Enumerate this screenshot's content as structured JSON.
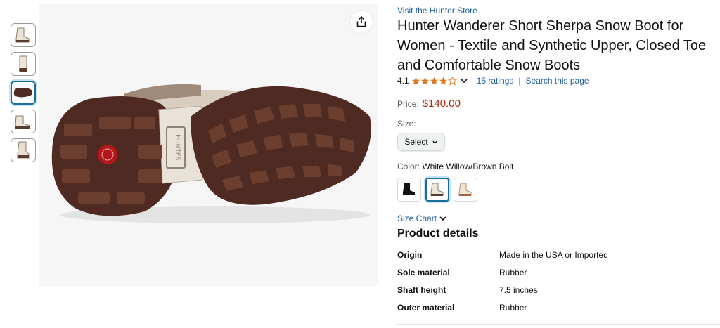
{
  "gallery": {
    "thumbnails": [
      "boot-side-view",
      "boot-front-view",
      "boot-sole-view",
      "boot-pair-view",
      "boot-model-view"
    ],
    "selected_index": 2,
    "main_image": "boot-sole-view",
    "share_icon": "share-icon"
  },
  "product": {
    "store_link": "Visit the Hunter Store",
    "title_line1": "Hunter Wanderer Short Sherpa Snow Boot for",
    "title_line2": "Women - Textile and Synthetic Upper, Closed Toe",
    "title_line3": "and Comfortable Snow Boots",
    "rating": "4.1",
    "rating_value": 4.1,
    "ratings_count": "15 ratings",
    "separator": "|",
    "search_link": "Search this page",
    "price_label": "Price:",
    "price": "$140.00",
    "size_label": "Size:",
    "size_select": "Select",
    "color_label": "Color:",
    "color_value": "White Willow/Brown Bolt",
    "color_swatches": [
      "black-boot",
      "white-willow-boot",
      "cream-boot"
    ],
    "selected_swatch": 1,
    "size_chart": "Size Chart",
    "details_heading": "Product details",
    "details": [
      {
        "key": "Origin",
        "value": "Made in the USA or Imported"
      },
      {
        "key": "Sole material",
        "value": "Rubber"
      },
      {
        "key": "Shaft height",
        "value": "7.5 inches"
      },
      {
        "key": "Outer material",
        "value": "Rubber"
      }
    ]
  },
  "colors": {
    "link": "#2162a1",
    "price": "#b12704",
    "star": "#de7921",
    "selected_border": "#1a6e9e",
    "sole_brown": "#4e2a22"
  }
}
